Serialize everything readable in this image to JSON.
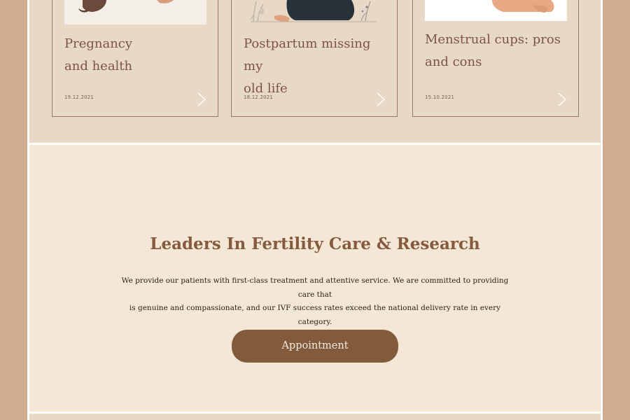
{
  "articles": [
    {
      "title_line1": "Pregnancy",
      "title_line2": "and health",
      "date": "19.12.2021",
      "arrow_icon": "chevron-right-icon"
    },
    {
      "title_line1": "Postpartum missing my",
      "title_line2": "old life",
      "date": "18.12.2021",
      "arrow_icon": "chevron-right-icon"
    },
    {
      "title_line1": "Menstrual cups: pros",
      "title_line2": "and cons",
      "date": "15.10.2021",
      "arrow_icon": "chevron-right-icon"
    }
  ],
  "hero": {
    "title": "Leaders In Fertility Care & Research",
    "text_line1": "We provide our patients with first-class treatment and attentive service. We are committed to providing care that",
    "text_line2": "is genuine and compassionate, and our IVF success rates exceed the national delivery rate in every category.",
    "button_label": "Appointment"
  },
  "colors": {
    "page_background": "#d1ab8d",
    "cards_background": "#e8d9c6",
    "hero_background": "#f4e7d6",
    "accent_brown": "#825a3c",
    "title_brown": "#7d5341"
  }
}
